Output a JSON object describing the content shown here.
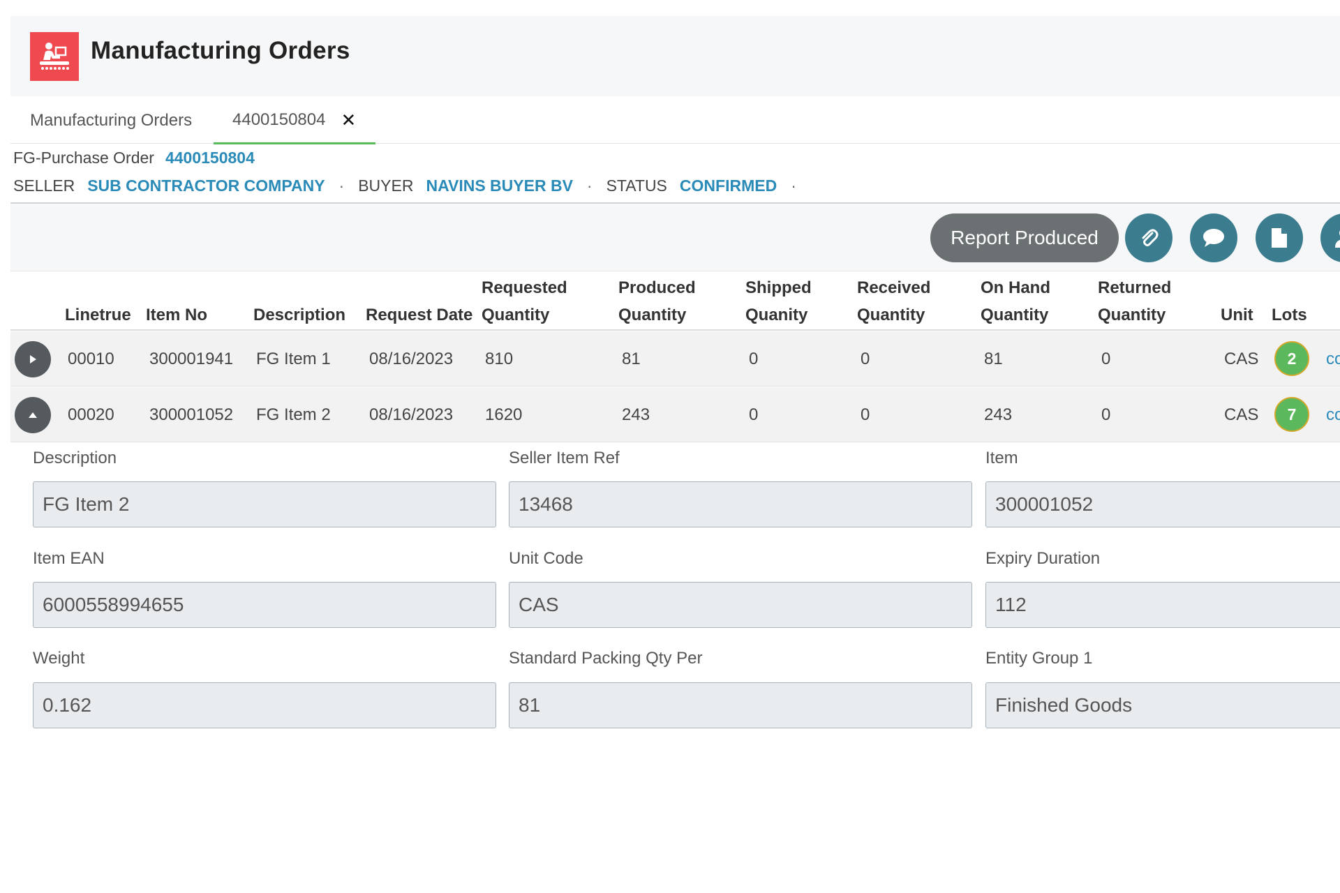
{
  "header": {
    "title": "Manufacturing Orders",
    "icon": "factory-worker-icon",
    "icon_color": "#ef4a4f"
  },
  "tabs": [
    {
      "label": "Manufacturing Orders"
    },
    {
      "label": "4400150804",
      "active": true
    }
  ],
  "order": {
    "type_label": "FG-Purchase Order",
    "number": "4400150804",
    "seller_label": "SELLER",
    "seller": "SUB CONTRACTOR COMPANY",
    "buyer_label": "BUYER",
    "buyer": "NAVINS BUYER BV",
    "status_label": "STATUS",
    "status": "CONFIRMED"
  },
  "toolbar": {
    "report_label": "Report Produced",
    "icons": [
      "paperclip-icon",
      "comment-icon",
      "document-icon",
      "user-icon"
    ]
  },
  "table": {
    "headers": {
      "linetrue": "Linetrue",
      "item_no": "Item No",
      "description": "Description",
      "request_date": "Request Date",
      "requested_1": "Requested",
      "requested_2": "Quantity",
      "produced_1": "Produced",
      "produced_2": "Quantity",
      "shipped_1": "Shipped",
      "shipped_2": "Quanity",
      "received_1": "Received",
      "received_2": "Quantity",
      "onhand_1": "On Hand",
      "onhand_2": "Quantity",
      "returned_1": "Returned",
      "returned_2": "Quantity",
      "unit": "Unit",
      "lots": "Lots"
    },
    "rows": [
      {
        "line": "00010",
        "item_no": "300001941",
        "description": "FG Item 1",
        "request_date": "08/16/2023",
        "requested": "810",
        "produced": "81",
        "shipped": "0",
        "received": "0",
        "on_hand": "81",
        "returned": "0",
        "unit": "CAS",
        "lots": "2",
        "link": "co",
        "expanded": false
      },
      {
        "line": "00020",
        "item_no": "300001052",
        "description": "FG Item 2",
        "request_date": "08/16/2023",
        "requested": "1620",
        "produced": "243",
        "shipped": "0",
        "received": "0",
        "on_hand": "243",
        "returned": "0",
        "unit": "CAS",
        "lots": "7",
        "link": "co",
        "expanded": true
      }
    ]
  },
  "detail": {
    "description": {
      "label": "Description",
      "value": "FG Item 2"
    },
    "seller_item_ref": {
      "label": "Seller Item Ref",
      "value": "13468"
    },
    "item": {
      "label": "Item",
      "value": "300001052"
    },
    "item_ean": {
      "label": "Item EAN",
      "value": "6000558994655"
    },
    "unit_code": {
      "label": "Unit Code",
      "value": "CAS"
    },
    "expiry_duration": {
      "label": "Expiry Duration",
      "value": "112"
    },
    "weight": {
      "label": "Weight",
      "value": "0.162"
    },
    "standard_packing": {
      "label": "Standard Packing Qty Per",
      "value": "81"
    },
    "entity_group": {
      "label": "Entity Group 1",
      "value": "Finished Goods"
    }
  },
  "colors": {
    "link": "#2a8ab8",
    "accent_green": "#5cb85c",
    "icon_button": "#3b7d8f",
    "report_button": "#6b7073"
  }
}
